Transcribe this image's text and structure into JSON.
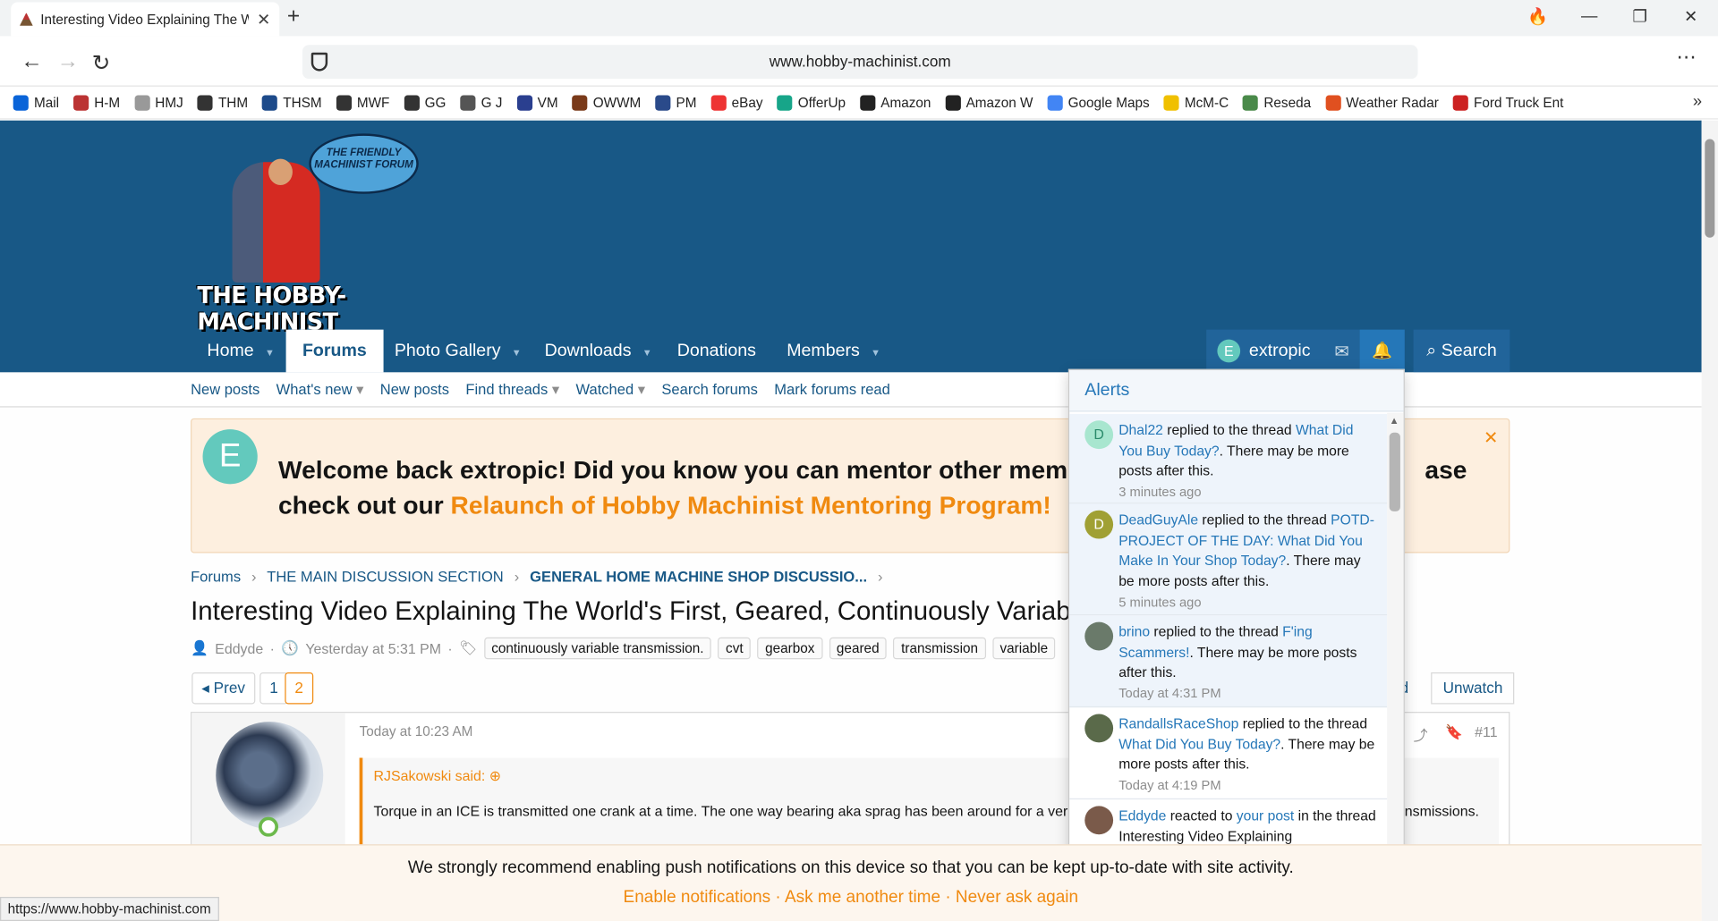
{
  "browser": {
    "tab_title": "Interesting Video Explaining The W",
    "url": "www.hobby-machinist.com",
    "status_url": "https://www.hobby-machinist.com",
    "bookmarks": [
      "Mail",
      "H-M",
      "HMJ",
      "THM",
      "THSM",
      "MWF",
      "GG",
      "G J",
      "VM",
      "OWWM",
      "PM",
      "eBay",
      "OfferUp",
      "Amazon",
      "Amazon W",
      "Google Maps",
      "McM-C",
      "Reseda",
      "Weather Radar",
      "Ford Truck Ent"
    ]
  },
  "site": {
    "logo_bubble": "THE FRIENDLY MACHINIST FORUM",
    "logo_text": "THE HOBBY-MACHINIST",
    "nav": {
      "home": "Home",
      "forums": "Forums",
      "photo": "Photo Gallery",
      "downloads": "Downloads",
      "donations": "Donations",
      "members": "Members"
    },
    "user": {
      "initial": "E",
      "name": "extropic"
    },
    "search_label": "Search",
    "subnav": [
      "New posts",
      "What's new",
      "New posts",
      "Find threads",
      "Watched",
      "Search forums",
      "Mark forums read"
    ]
  },
  "notice": {
    "initial": "E",
    "text1": "Welcome back extropic! Did you know you can mentor other memb",
    "text1_tail": "ase",
    "text2": "check out our ",
    "link": "Relaunch of Hobby Machinist Mentoring Program!"
  },
  "thread": {
    "breadcrumb": [
      "Forums",
      "THE MAIN DISCUSSION SECTION",
      "GENERAL HOME MACHINE SHOP DISCUSSIO..."
    ],
    "title": "Interesting Video Explaining The World's First, Geared, Continuously Variab",
    "author": "Eddyde",
    "date": "Yesterday at 5:31 PM",
    "tags": [
      "continuously variable transmission.",
      "cvt",
      "gearbox",
      "geared",
      "transmission",
      "variable"
    ],
    "pages": {
      "prev": "Prev",
      "p1": "1",
      "p2": "2"
    },
    "unwatch": "Unwatch",
    "read_partial": "ad"
  },
  "post": {
    "date": "Today at 10:23 AM",
    "number": "#11",
    "quote_author": "RJSakowski said:",
    "quote_text": "Torque in an ICE is transmitted one crank at a time. The one way bearing aka sprag has been around for a ver",
    "quote_tail": "nsmissions."
  },
  "alerts": {
    "title": "Alerts",
    "items": [
      {
        "initial": "D",
        "user": "Dhal22",
        "action": " replied to the thread ",
        "link": "What Did You Buy Today?",
        "rest": ". There may be more posts after this.",
        "time": "3 minutes ago"
      },
      {
        "initial": "D",
        "user": "DeadGuyAle",
        "action": " replied to the thread ",
        "link": "POTD- PROJECT OF THE DAY: What Did You Make In Your Shop Today?",
        "rest": ". There may be more posts after this.",
        "time": "5 minutes ago"
      },
      {
        "initial": "",
        "user": "brino",
        "action": " replied to the thread ",
        "link": "F'ing Scammers!",
        "rest": ". There may be more posts after this.",
        "time": "Today at 4:31 PM"
      },
      {
        "initial": "",
        "user": "RandallsRaceShop",
        "action": " replied to the thread ",
        "link": "What Did You Buy Today?",
        "rest": ". There may be more posts after this.",
        "time": "Today at 4:19 PM"
      },
      {
        "initial": "",
        "user": "Eddyde",
        "action": " reacted to ",
        "link": "your post",
        "rest": " in the thread Interesting Video Explaining",
        "time": ""
      }
    ]
  },
  "push": {
    "text": "We strongly recommend enabling push notifications on this device so that you can be kept up-to-date with site activity.",
    "enable": "Enable notifications",
    "later": "Ask me another time",
    "never": "Never ask again"
  },
  "colors": {
    "header": "#185886",
    "accent": "#f08a10",
    "link": "#2577b8"
  }
}
